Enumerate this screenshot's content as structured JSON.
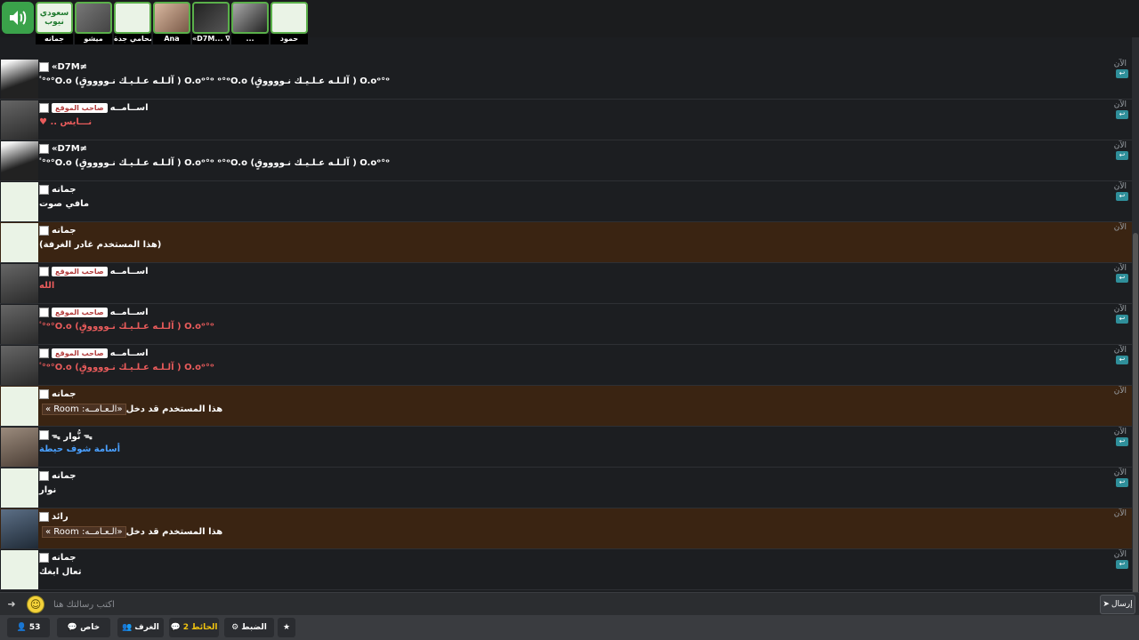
{
  "topbar": {
    "mics": [
      {
        "name": "جمانه",
        "thumb": "logo",
        "line1": "سعودي",
        "line2": "نيوب"
      },
      {
        "name": "ميشو",
        "thumb": "gray",
        "line1": "",
        "line2": ""
      },
      {
        "name": "محامي جدة",
        "thumb": "logo",
        "line1": "",
        "line2": ""
      },
      {
        "name": "Ana",
        "thumb": "girl",
        "line1": "",
        "line2": ""
      },
      {
        "name": "«D7M... ∇",
        "thumb": "sil",
        "line1": "",
        "line2": ""
      },
      {
        "name": "...",
        "thumb": "bw",
        "line1": "",
        "line2": ""
      },
      {
        "name": "حمود",
        "thumb": "logo",
        "line1": "",
        "line2": ""
      }
    ]
  },
  "messages": [
    {
      "user": "«D7M≠",
      "badge": "",
      "text": "ٴ°ᵒ°O.o (آلـلـه عـلـيـك نـووووقٍ ) O.oᵒ°ᵒ ᵒ°ᵒO.o (آلـلـه عـلـيـك نـووووقٍ ) O.oᵒ°ᵒ",
      "color": "white",
      "avatar": "dark",
      "time": "الآن",
      "sys": false
    },
    {
      "user": "اســامــه",
      "badge": "صاحب الموقع",
      "text": "♥ .. نـــايس",
      "color": "red",
      "avatar": "man",
      "time": "الآن",
      "sys": false
    },
    {
      "user": "«D7M≠",
      "badge": "",
      "text": "ٴ°ᵒ°O.o (آلـلـه عـلـيـك نـووووقٍ ) O.oᵒ°ᵒ ᵒ°ᵒO.o (آلـلـه عـلـيـك نـووووقٍ ) O.oᵒ°ᵒ",
      "color": "white",
      "avatar": "dark",
      "time": "الآن",
      "sys": false
    },
    {
      "user": "جمانه",
      "badge": "",
      "text": "مافي صوت",
      "color": "white",
      "avatar": "logo",
      "time": "الآن",
      "sys": false
    },
    {
      "user": "جمانه",
      "badge": "",
      "text": "(هذا المستخدم غادر الغرفة)",
      "color": "white",
      "avatar": "logo",
      "time": "الآن",
      "sys": true
    },
    {
      "user": "اســامــه",
      "badge": "صاحب الموقع",
      "text": "الله",
      "color": "red",
      "avatar": "man",
      "time": "الآن",
      "sys": false
    },
    {
      "user": "اســامــه",
      "badge": "صاحب الموقع",
      "text": "ٴ°ᵒ°O.o (آلـلـه عـلـيـك نـووووقٍ ) O.oᵒ°ᵒ",
      "color": "red",
      "avatar": "man",
      "time": "الآن",
      "sys": false
    },
    {
      "user": "اســامــه",
      "badge": "صاحب الموقع",
      "text": "ٴ°ᵒ°O.o (آلـلـه عـلـيـك نـووووقٍ ) O.oᵒ°ᵒ",
      "color": "red",
      "avatar": "man",
      "time": "الآن",
      "sys": false
    },
    {
      "user": "جمانه",
      "badge": "",
      "text": "هذا المستخدم قد دخل",
      "room": "« Room :الـعـامــه»",
      "color": "white",
      "avatar": "logo",
      "time": "الآن",
      "sys": true
    },
    {
      "user": "ᯓ نُّوار ᯓ",
      "badge": "",
      "text": "أسامة شوف حيطة",
      "color": "blue",
      "avatar": "man2",
      "time": "الآن",
      "sys": false
    },
    {
      "user": "جمانه",
      "badge": "",
      "text": "نوار",
      "color": "white",
      "avatar": "logo",
      "time": "الآن",
      "sys": false
    },
    {
      "user": "رائد",
      "badge": "",
      "text": "هذا المستخدم قد دخل",
      "room": "« Room :الـعـامــه»",
      "color": "white",
      "avatar": "man3",
      "time": "الآن",
      "sys": true
    },
    {
      "user": "جمانه",
      "badge": "",
      "text": "تعال ابغك",
      "color": "white",
      "avatar": "logo",
      "time": "الآن",
      "sys": false
    }
  ],
  "input": {
    "placeholder": "اكتب رسالتك هنا",
    "send_label": "إرسال"
  },
  "bottomnav": {
    "online_count": "53",
    "private_label": "خاص",
    "rooms_label": "الغرف",
    "wall_label": "الحائط",
    "wall_count": "2",
    "settings_label": "الضبط"
  },
  "colors": {
    "accent": "#3aa24a",
    "system_row": "#3a2412",
    "owner_red": "#e85b5b",
    "link_blue": "#4aa0ff"
  }
}
